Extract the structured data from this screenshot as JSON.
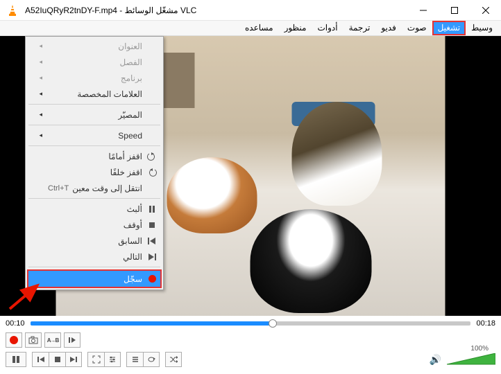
{
  "title": "A52IuQRyR2tnDY-F.mp4 - مشغّل الوسائط VLC",
  "menubar": [
    "وسيط",
    "تشغيل",
    "صوت",
    "فديو",
    "ترجمة",
    "أدوات",
    "منظور",
    "مساعده"
  ],
  "menubar_active_index": 1,
  "dropdown": {
    "items": [
      {
        "label": "العنوان",
        "disabled": true,
        "submenu": true
      },
      {
        "label": "الفصل",
        "disabled": true,
        "submenu": true
      },
      {
        "label": "برنامج",
        "disabled": true,
        "submenu": true
      },
      {
        "label": "العلامات المخصصة",
        "submenu": true
      },
      {
        "sep": true
      },
      {
        "label": "المصيّر",
        "submenu": true
      },
      {
        "sep": true
      },
      {
        "label": "Speed",
        "submenu": true
      },
      {
        "sep": true
      },
      {
        "label": "اقفز أمامًا",
        "icon": "jump-forward"
      },
      {
        "label": "اقفز خلفًا",
        "icon": "jump-back"
      },
      {
        "label": "انتقل إلى وقت معين",
        "shortcut": "Ctrl+T"
      },
      {
        "sep": true
      },
      {
        "label": "ألبث",
        "icon": "pause"
      },
      {
        "label": "أوقف",
        "icon": "stop"
      },
      {
        "label": "السابق",
        "icon": "prev"
      },
      {
        "label": "التالي",
        "icon": "next"
      },
      {
        "sep": true
      },
      {
        "label": "سجّل",
        "icon": "record",
        "highlight": true
      }
    ]
  },
  "time": {
    "current": "00:10",
    "total": "00:18",
    "progress_pct": 55
  },
  "volume": {
    "pct": "100%"
  }
}
